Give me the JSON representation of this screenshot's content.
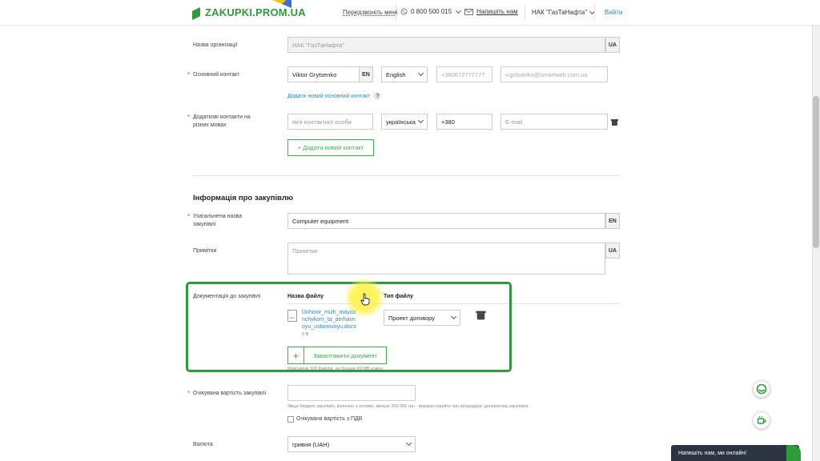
{
  "header": {
    "logo_text": "ZAKUPKI.PROM.UA",
    "callback_link": "Передзвоніть мені",
    "phone": "0 800 500 015",
    "mail_link": "Напишіть нам",
    "org_select": "НАК \"ГазТаНафта\"",
    "exit_link": "Вийти"
  },
  "contacts": {
    "org_name_label": "Назва організації",
    "org_name_value": "НАК \"ГазТаНафта\"",
    "org_lang": "UA",
    "main_contact_label": "Основний контакт",
    "main_contact_name": "Viktor Grytsenko",
    "main_contact_lang_tag": "EN",
    "main_contact_language": "English",
    "main_contact_phone": "+380672777777",
    "main_contact_email": "v.gritsenko@smartweb.com.ua",
    "add_main_contact_link": "Додати новий основний контакт",
    "help_mark": "?",
    "extra_contacts_label": "Додаткові контакти на різних мовах",
    "extra_name_placeholder": "Ім'я контактної особи",
    "extra_language": "українська",
    "extra_phone": "+380",
    "extra_email_placeholder": "E-mail",
    "add_contact_button": "+ Додати новий контакт"
  },
  "procurement": {
    "section_title": "Інформація про закупівлю",
    "general_name_label": "Узагальнена назва закупівлі",
    "general_name_value": "Computer equipment",
    "general_name_lang": "EN",
    "notes_label": "Примітки",
    "notes_placeholder": "Примітки",
    "notes_lang": "UA",
    "docs_label": "Документація до закупівлі",
    "docs_col_file_name": "Назва файлу",
    "docs_col_file_type": "Тип файлу",
    "file_icon_text": "docx",
    "file_name": "Dohovir_mizh_maydanchykom_ta_derhavnoyu_ustanovoyu.docx",
    "file_size": "0 B",
    "file_type_select": "Проект договору",
    "upload_plus": "+",
    "upload_button": "Завантажити документ",
    "upload_hint": "Максимум 100 файлів, не більше 49 МВ кожен",
    "expected_value_label": "Очікувана вартість закупівлі",
    "expected_value_hint": "Якщо бюджет закупівлі, включно з лотами, менше 200 000 грн - використовуйте тип процедури: допорогова закупівля",
    "vat_label": "Очікувана вартість з ПДВ",
    "currency_label": "Валюта",
    "currency_value": "гривня (UAH)"
  },
  "widgets": {
    "chat_text": "Напишіть нам, ми онлайн!"
  },
  "colors": {
    "brand_green": "#2e9a3c",
    "link_blue": "#2b8ac6",
    "required_red": "#d9534f"
  }
}
